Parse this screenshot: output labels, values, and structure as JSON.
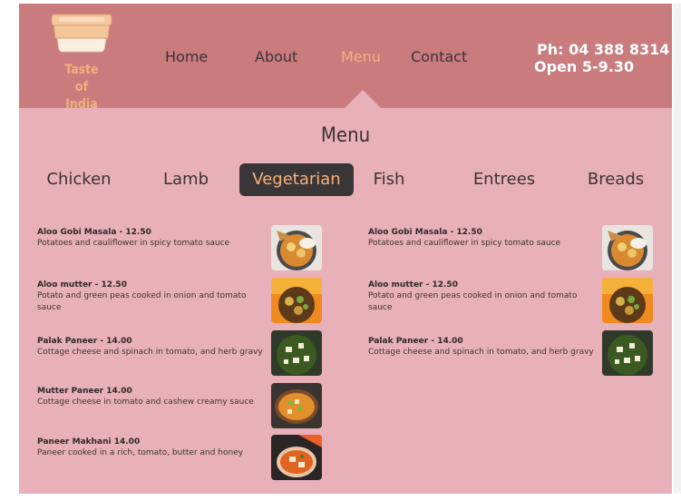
{
  "brand": {
    "logo_text_line1": "Taste",
    "logo_text_line2": "of",
    "logo_text_line3": "India"
  },
  "nav": {
    "home": "Home",
    "about": "About",
    "menu": "Menu",
    "contact": "Contact"
  },
  "contact": {
    "phone": "Ph: 04 388 8314",
    "hours": "Open 5-9.30"
  },
  "menu_title": "Menu",
  "tabs": {
    "chicken": "Chicken",
    "lamb": "Lamb",
    "vegetarian": "Vegetarian",
    "fish": "Fish",
    "entrees": "Entrees",
    "breads": "Breads"
  },
  "left_items": [
    {
      "title": "Aloo Gobi Masala - 12.50",
      "desc": "Potatoes and cauliflower in spicy tomato sauce"
    },
    {
      "title": "Aloo mutter - 12.50",
      "desc": "Potato and green peas cooked in onion and tomato sauce"
    },
    {
      "title": "Palak Paneer - 14.00",
      "desc": "Cottage cheese and spinach in tomato, and herb gravy"
    },
    {
      "title": "Mutter Paneer 14.00",
      "desc": "Cottage cheese in tomato and cashew creamy sauce"
    },
    {
      "title": "Paneer Makhani 14.00",
      "desc": "Paneer cooked in a rich, tomato, butter and honey"
    }
  ],
  "right_items": [
    {
      "title": "Aloo Gobi Masala - 12.50",
      "desc": "Potatoes and cauliflower in spicy tomato sauce"
    },
    {
      "title": "Aloo mutter - 12.50",
      "desc": "Potato and green peas cooked in onion and tomato sauce"
    },
    {
      "title": "Palak Paneer - 14.00",
      "desc": "Cottage cheese and spinach in tomato, and herb gravy"
    }
  ],
  "colors": {
    "header": "#c97b7e",
    "page": "#e8b0b8",
    "accent": "#f6b27a",
    "active_tab_bg": "#3a3536"
  }
}
